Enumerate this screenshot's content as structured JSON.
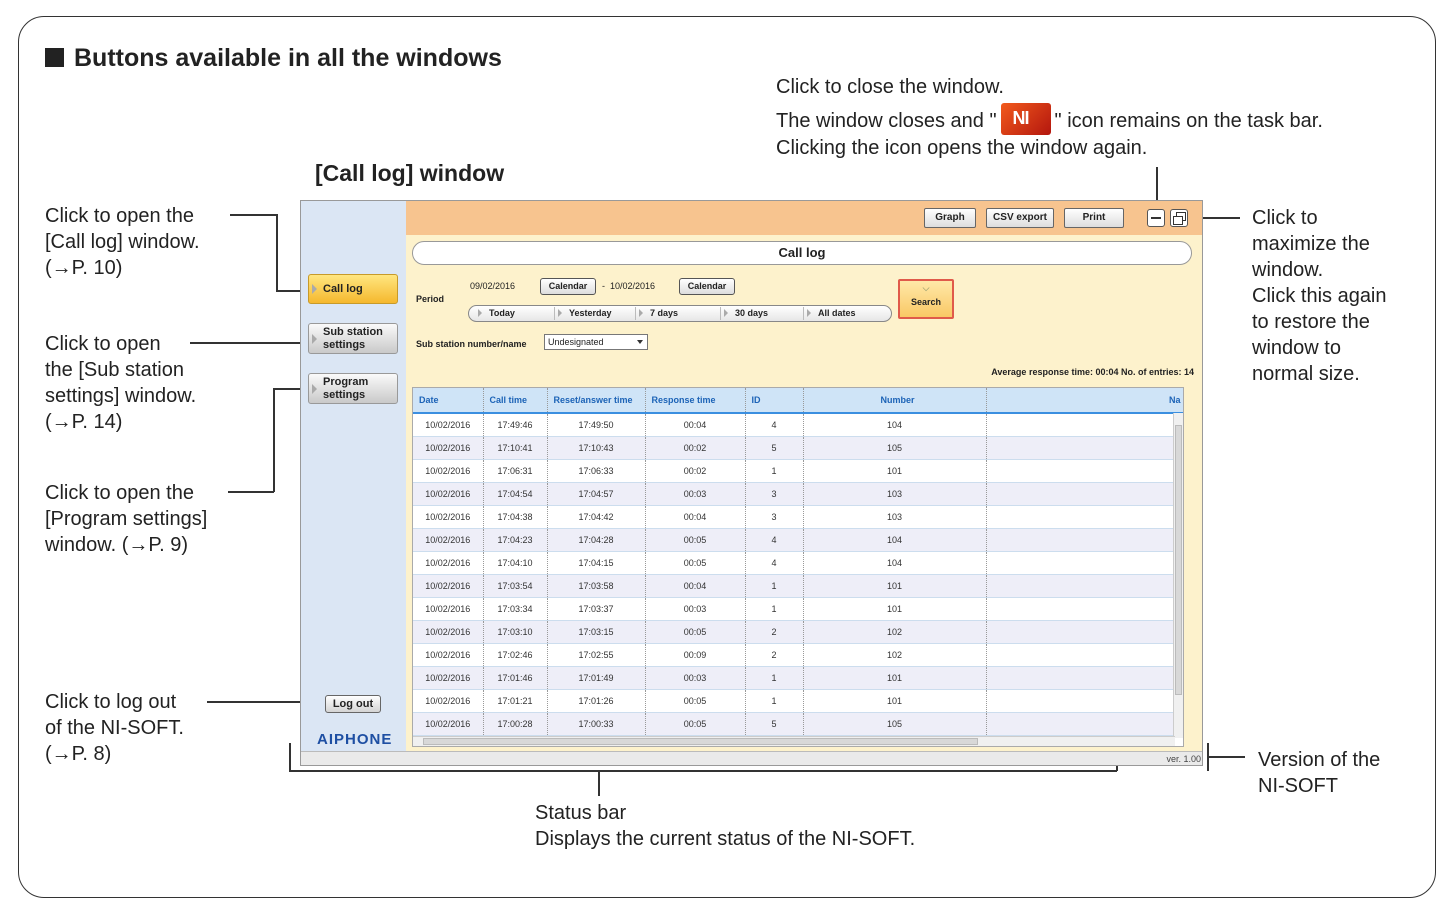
{
  "section_title": "Buttons available in all the windows",
  "window_title": "[Call log] window",
  "notes": {
    "close_line1": "Click to close the window.",
    "close_line2a": "The window closes and \"",
    "close_line2b": "\" icon remains on the task bar.",
    "close_line3": "Clicking the icon opens the window again.",
    "maximize": [
      "Click to",
      "maximize the",
      "window.",
      "Click this again",
      "to restore the",
      "window to",
      "normal size."
    ],
    "call_log": [
      "Click to open the",
      "[Call log] window.",
      "(→P. 10)"
    ],
    "sub_station": [
      "Click to open",
      "the [Sub station",
      "settings] window.",
      "(→P. 14)"
    ],
    "program": [
      "Click to open the",
      "[Program settings]",
      "window. (→P. 9)"
    ],
    "logout": [
      "Click to log out",
      "of the NI-SOFT.",
      "(→P. 8)"
    ],
    "version": [
      "Version of the",
      "NI-SOFT"
    ],
    "status_bar": [
      "Status bar",
      "Displays the current status of the NI-SOFT."
    ]
  },
  "app": {
    "icon_letters": "NI",
    "sidebar": {
      "call_log": "Call log",
      "sub_station_1": "Sub station",
      "sub_station_2": "settings",
      "program_1": "Program",
      "program_2": "settings",
      "logout": "Log out",
      "logo": "AIPHONE"
    },
    "toolbar": {
      "graph": "Graph",
      "csv": "CSV export",
      "print": "Print"
    },
    "title": "Call log",
    "period_label": "Period",
    "date_from": "09/02/2016",
    "calendar": "Calendar",
    "date_sep": "-",
    "date_to": "10/02/2016",
    "quick": [
      "Today",
      "Yesterday",
      "7 days",
      "30 days",
      "All dates"
    ],
    "search": "Search",
    "sub_label": "Sub station number/name",
    "sub_value": "Undesignated",
    "avg_text": "Average response time:   00:04   No. of entries:   14",
    "columns": [
      "Date",
      "Call time",
      "Reset/answer time",
      "Response time",
      "ID",
      "Number",
      "Na"
    ],
    "rows": [
      [
        "10/02/2016",
        "17:49:46",
        "17:49:50",
        "00:04",
        "4",
        "104"
      ],
      [
        "10/02/2016",
        "17:10:41",
        "17:10:43",
        "00:02",
        "5",
        "105"
      ],
      [
        "10/02/2016",
        "17:06:31",
        "17:06:33",
        "00:02",
        "1",
        "101"
      ],
      [
        "10/02/2016",
        "17:04:54",
        "17:04:57",
        "00:03",
        "3",
        "103"
      ],
      [
        "10/02/2016",
        "17:04:38",
        "17:04:42",
        "00:04",
        "3",
        "103"
      ],
      [
        "10/02/2016",
        "17:04:23",
        "17:04:28",
        "00:05",
        "4",
        "104"
      ],
      [
        "10/02/2016",
        "17:04:10",
        "17:04:15",
        "00:05",
        "4",
        "104"
      ],
      [
        "10/02/2016",
        "17:03:54",
        "17:03:58",
        "00:04",
        "1",
        "101"
      ],
      [
        "10/02/2016",
        "17:03:34",
        "17:03:37",
        "00:03",
        "1",
        "101"
      ],
      [
        "10/02/2016",
        "17:03:10",
        "17:03:15",
        "00:05",
        "2",
        "102"
      ],
      [
        "10/02/2016",
        "17:02:46",
        "17:02:55",
        "00:09",
        "2",
        "102"
      ],
      [
        "10/02/2016",
        "17:01:46",
        "17:01:49",
        "00:03",
        "1",
        "101"
      ],
      [
        "10/02/2016",
        "17:01:21",
        "17:01:26",
        "00:05",
        "1",
        "101"
      ],
      [
        "10/02/2016",
        "17:00:28",
        "17:00:33",
        "00:05",
        "5",
        "105"
      ]
    ],
    "version": "ver. 1.00"
  }
}
